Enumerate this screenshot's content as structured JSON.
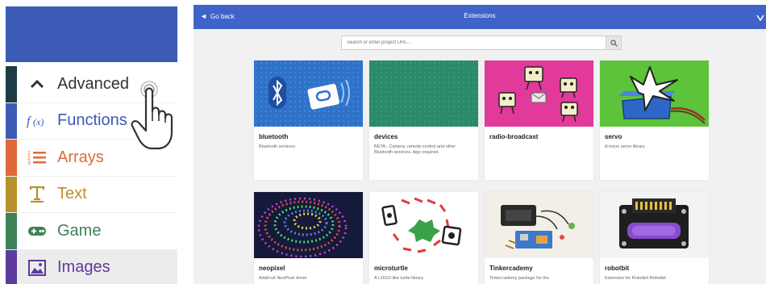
{
  "toolbox": {
    "categories": [
      {
        "id": "advanced",
        "label": "Advanced",
        "color": "#1c3b45",
        "text_color": "#333333",
        "icon": "chevron-up-icon"
      },
      {
        "id": "functions",
        "label": "Functions",
        "color": "#3c5bb4",
        "text_color": "#3c5bb4",
        "icon": "function-icon"
      },
      {
        "id": "arrays",
        "label": "Arrays",
        "color": "#e0693a",
        "text_color": "#e0693a",
        "icon": "list-icon"
      },
      {
        "id": "text",
        "label": "Text",
        "color": "#b8912d",
        "text_color": "#b8912d",
        "icon": "text-icon"
      },
      {
        "id": "game",
        "label": "Game",
        "color": "#3d8257",
        "text_color": "#3d8257",
        "icon": "gamepad-icon"
      },
      {
        "id": "images",
        "label": "Images",
        "color": "#5c3a9e",
        "text_color": "#5c3a9e",
        "icon": "image-icon"
      }
    ]
  },
  "extensions": {
    "go_back": "Go back",
    "title": "Extensions",
    "search_placeholder": "Search or enter project URL...",
    "cards": [
      {
        "name": "bluetooth",
        "description": "Bluetooth services"
      },
      {
        "name": "devices",
        "description": "BETA - Camera, remote control and other Bluetooth services. App required."
      },
      {
        "name": "radio-broadcast",
        "description": ""
      },
      {
        "name": "servo",
        "description": "A micro servo library"
      },
      {
        "name": "neopixel",
        "description": "AdaFruit NeoPixel driver"
      },
      {
        "name": "microturtle",
        "description": "A LOGO-like turtle library"
      },
      {
        "name": "Tinkercademy",
        "description": "Tinkercademy package for the"
      },
      {
        "name": "robotbit",
        "description": "Extension for Robotbit Robotkit"
      }
    ]
  },
  "colors": {
    "header_blue": "#3b5bb6",
    "topbar_blue": "#3f63c8",
    "bluetooth_bg": "#2f72c9",
    "devices_bg": "#2a8a6a",
    "radio_bg": "#e13a9b",
    "servo_bg": "#5cc33a"
  }
}
